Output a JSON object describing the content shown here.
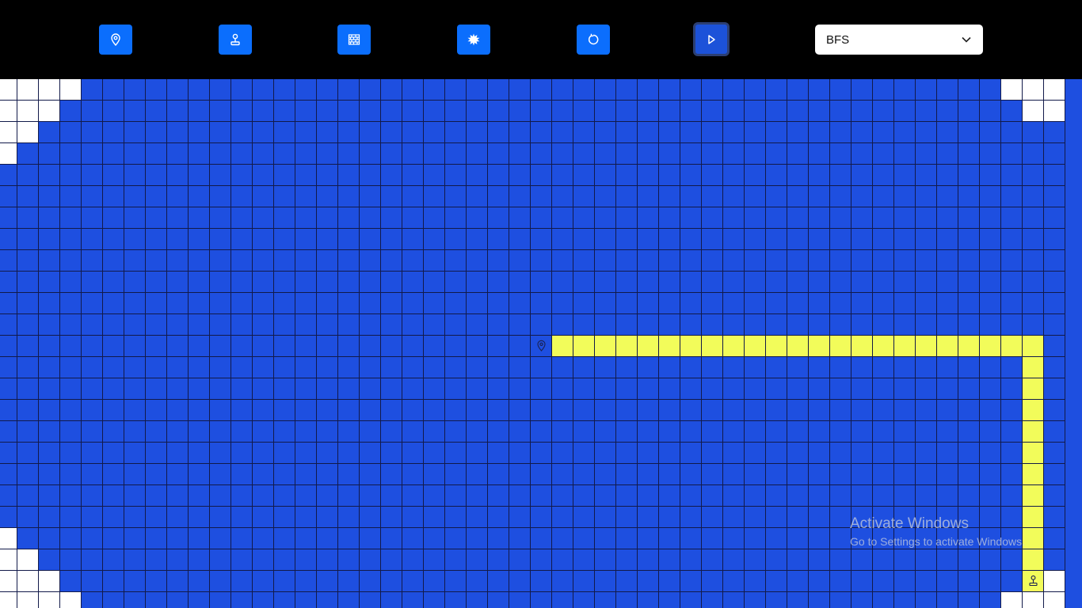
{
  "toolbar": {
    "buttons": [
      {
        "name": "set-start-button",
        "icon": "map-pin-icon"
      },
      {
        "name": "set-target-button",
        "icon": "joystick-icon"
      },
      {
        "name": "draw-walls-button",
        "icon": "brick-wall-icon"
      },
      {
        "name": "random-maze-button",
        "icon": "burst-icon"
      },
      {
        "name": "reset-button",
        "icon": "rotate-icon"
      },
      {
        "name": "run-button",
        "icon": "play-icon",
        "active": true
      }
    ],
    "algorithm": {
      "selected": "BFS",
      "icon": "chevron-down-icon"
    }
  },
  "grid": {
    "columns": 50,
    "rows": 25,
    "colors": {
      "visited": "#1e4fe0",
      "unvisited": "#ffffff",
      "path": "#f2fc5a",
      "grid_line": "#121a4a",
      "button": "#0b6efd"
    },
    "start": {
      "row": 12,
      "col": 25,
      "icon": "map-pin-icon"
    },
    "target": {
      "row": 23,
      "col": 48,
      "icon": "joystick-icon"
    },
    "unvisited_cells": [
      [
        0,
        0
      ],
      [
        0,
        1
      ],
      [
        0,
        2
      ],
      [
        0,
        3
      ],
      [
        1,
        0
      ],
      [
        1,
        1
      ],
      [
        1,
        2
      ],
      [
        2,
        0
      ],
      [
        2,
        1
      ],
      [
        3,
        0
      ],
      [
        0,
        47
      ],
      [
        0,
        48
      ],
      [
        0,
        49
      ],
      [
        1,
        48
      ],
      [
        1,
        49
      ],
      [
        21,
        0
      ],
      [
        22,
        0
      ],
      [
        22,
        1
      ],
      [
        23,
        0
      ],
      [
        23,
        1
      ],
      [
        23,
        2
      ],
      [
        24,
        0
      ],
      [
        24,
        1
      ],
      [
        24,
        2
      ],
      [
        24,
        3
      ],
      [
        23,
        49
      ],
      [
        24,
        47
      ],
      [
        24,
        48
      ],
      [
        24,
        49
      ]
    ],
    "path_cells": [
      [
        12,
        26
      ],
      [
        12,
        27
      ],
      [
        12,
        28
      ],
      [
        12,
        29
      ],
      [
        12,
        30
      ],
      [
        12,
        31
      ],
      [
        12,
        32
      ],
      [
        12,
        33
      ],
      [
        12,
        34
      ],
      [
        12,
        35
      ],
      [
        12,
        36
      ],
      [
        12,
        37
      ],
      [
        12,
        38
      ],
      [
        12,
        39
      ],
      [
        12,
        40
      ],
      [
        12,
        41
      ],
      [
        12,
        42
      ],
      [
        12,
        43
      ],
      [
        12,
        44
      ],
      [
        12,
        45
      ],
      [
        12,
        46
      ],
      [
        12,
        47
      ],
      [
        12,
        48
      ],
      [
        13,
        48
      ],
      [
        14,
        48
      ],
      [
        15,
        48
      ],
      [
        16,
        48
      ],
      [
        17,
        48
      ],
      [
        18,
        48
      ],
      [
        19,
        48
      ],
      [
        20,
        48
      ],
      [
        21,
        48
      ],
      [
        22,
        48
      ]
    ]
  },
  "watermark": {
    "line1": "Activate Windows",
    "line2": "Go to Settings to activate Windows."
  }
}
